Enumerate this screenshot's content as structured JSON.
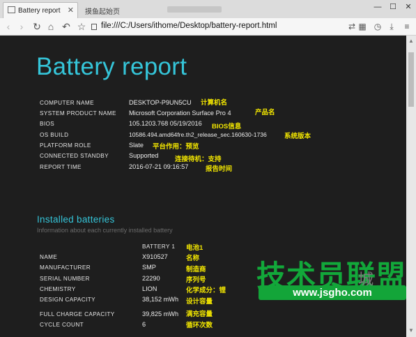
{
  "browser": {
    "active_tab": "Battery report",
    "inactive_tab": "摸鱼起始页",
    "url": "file:///C:/Users/ithome/Desktop/battery-report.html"
  },
  "report": {
    "title": "Battery report",
    "system_info": [
      {
        "label": "COMPUTER NAME",
        "value": "DESKTOP-P9UN5CU",
        "note": "计算机名"
      },
      {
        "label": "SYSTEM PRODUCT NAME",
        "value": "Microsoft Corporation Surface Pro 4",
        "note": "产品名"
      },
      {
        "label": "BIOS",
        "value": "105.1203.768 05/19/2016",
        "note": "BIOS信息"
      },
      {
        "label": "OS BUILD",
        "value": "10586.494.amd64fre.th2_release_sec.160630-1736",
        "note": "系统版本"
      },
      {
        "label": "PLATFORM ROLE",
        "value": "Slate",
        "note": "平台作用：预览"
      },
      {
        "label": "CONNECTED STANDBY",
        "value": "Supported",
        "note": "连接待机：支持"
      },
      {
        "label": "REPORT TIME",
        "value": "2016-07-21 09:16:57",
        "note": "报告时间"
      }
    ],
    "installed": {
      "heading": "Installed batteries",
      "subtitle": "Information about each currently installed battery",
      "battery_header": "BATTERY 1",
      "battery_header_note": "电池1",
      "rows": [
        {
          "label": "NAME",
          "value": "X910527",
          "note": "名称"
        },
        {
          "label": "MANUFACTURER",
          "value": "SMP",
          "note": "制造商"
        },
        {
          "label": "SERIAL NUMBER",
          "value": "22290",
          "note": "序列号"
        },
        {
          "label": "CHEMISTRY",
          "value": "LION",
          "note": "化学成分：锂"
        },
        {
          "label": "DESIGN CAPACITY",
          "value": "38,152 mWh",
          "note": "设计容量"
        },
        {
          "label": "FULL CHARGE CAPACITY",
          "value": "39,825 mWh",
          "note": "满充容量"
        },
        {
          "label": "CYCLE COUNT",
          "value": "6",
          "note": "循环次数"
        }
      ]
    }
  },
  "watermark": {
    "brand": "技术员联盟",
    "brand_suffix": "城",
    "url": "www.jsgho.com"
  }
}
